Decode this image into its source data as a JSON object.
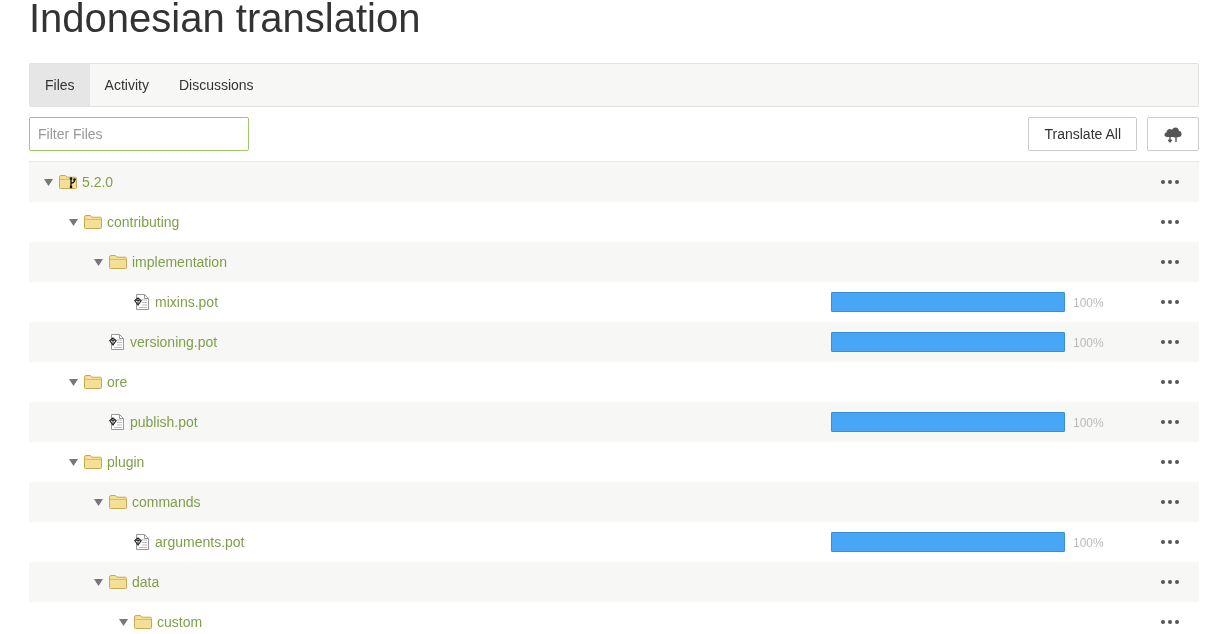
{
  "title": "Indonesian translation",
  "tabs": [
    {
      "label": "Files",
      "selected": true
    },
    {
      "label": "Activity",
      "selected": false
    },
    {
      "label": "Discussions",
      "selected": false
    }
  ],
  "filter": {
    "placeholder": "Filter Files"
  },
  "toolbar": {
    "translate_button": "Translate All"
  },
  "tree": [
    {
      "kind": "branch",
      "name": "5.2.0",
      "expanded": true,
      "children": [
        {
          "kind": "folder",
          "name": "contributing",
          "expanded": true,
          "children": [
            {
              "kind": "folder",
              "name": "implementation",
              "expanded": true,
              "children": [
                {
                  "kind": "file",
                  "name": "mixins.pot",
                  "level": 1,
                  "progress": "100%"
                }
              ]
            },
            {
              "kind": "file",
              "name": "versioning.pot",
              "level": 1,
              "progress": "100%"
            }
          ]
        },
        {
          "kind": "folder",
          "name": "ore",
          "expanded": true,
          "children": [
            {
              "kind": "file",
              "name": "publish.pot",
              "level": 1,
              "progress": "100%"
            }
          ]
        },
        {
          "kind": "folder",
          "name": "plugin",
          "expanded": true,
          "children": [
            {
              "kind": "folder",
              "name": "commands",
              "expanded": true,
              "children": [
                {
                  "kind": "file",
                  "name": "arguments.pot",
                  "level": 1,
                  "progress": "100%"
                }
              ]
            },
            {
              "kind": "folder",
              "name": "data",
              "expanded": true,
              "children": [
                {
                  "kind": "folder",
                  "name": "custom",
                  "expanded": true
                }
              ]
            }
          ]
        }
      ]
    }
  ]
}
